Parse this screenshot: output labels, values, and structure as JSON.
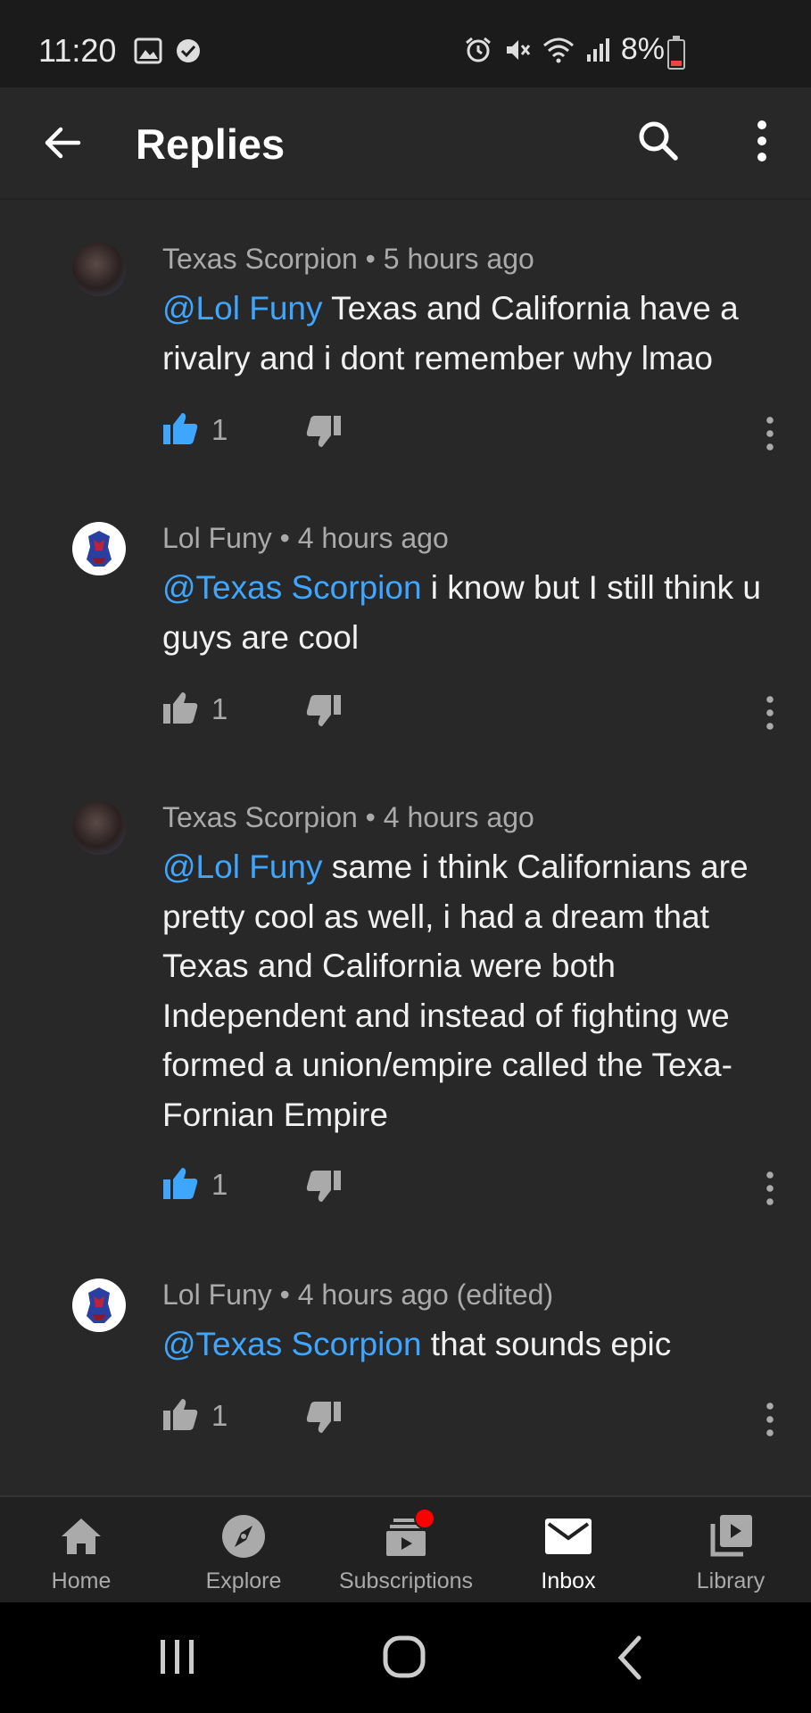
{
  "status": {
    "time": "11:20",
    "battery": "8%"
  },
  "header": {
    "title": "Replies",
    "back_icon": "arrow-back-icon",
    "search_icon": "search-icon",
    "more_icon": "more-vert-icon"
  },
  "comments": [
    {
      "author": "Texas Scorpion",
      "time": "5 hours ago",
      "mention": "@Lol Funy",
      "text": " Texas and California have a rivalry and i dont remember why lmao",
      "likes": "1",
      "liked": true
    },
    {
      "author": "Lol Funy",
      "time": "4 hours ago",
      "mention": "@Texas Scorpion",
      "text": " i know but I still think u guys are cool",
      "likes": "1",
      "liked": false
    },
    {
      "author": "Texas Scorpion",
      "time": "4 hours ago",
      "mention": "@Lol Funy",
      "text": " same i think Californians are pretty cool as well, i had a dream that Texas and California were both Independent and instead of fighting we formed a union/empire called the Texa-Fornian Empire",
      "likes": "1",
      "liked": true
    },
    {
      "author": "Lol Funy",
      "time": "4 hours ago (edited)",
      "mention": "@Texas Scorpion",
      "text": " that sounds epic",
      "likes": "1",
      "liked": false
    }
  ],
  "meta_separator": "•",
  "bottom_nav": [
    {
      "label": "Home",
      "icon": "home-icon"
    },
    {
      "label": "Explore",
      "icon": "compass-icon"
    },
    {
      "label": "Subscriptions",
      "icon": "subscriptions-icon"
    },
    {
      "label": "Inbox",
      "icon": "mail-icon"
    },
    {
      "label": "Library",
      "icon": "library-icon"
    }
  ],
  "colors": {
    "background": "#282828",
    "accent_blue": "#3ea6ff",
    "secondary_text": "#aaaaaa",
    "notification_red": "#ff0000"
  }
}
